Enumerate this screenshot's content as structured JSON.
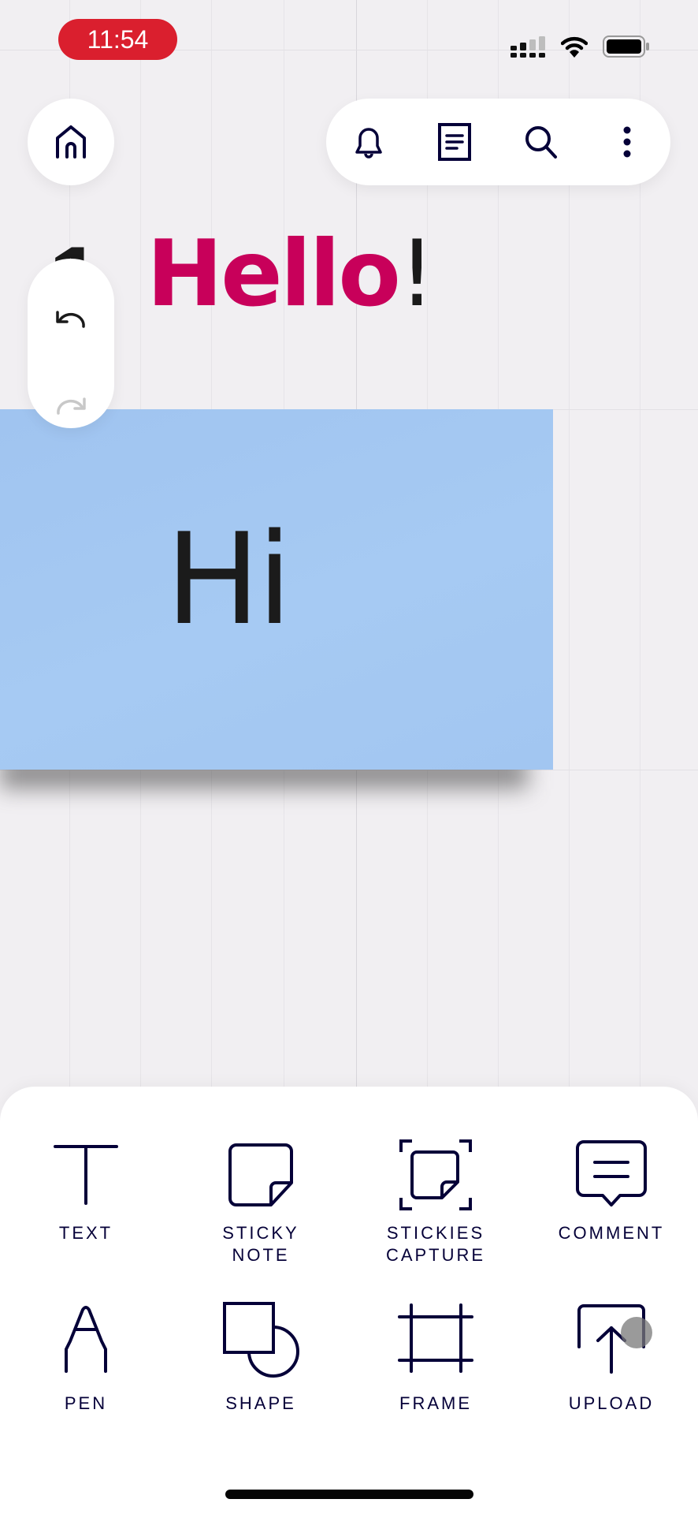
{
  "status_bar": {
    "time": "11:54",
    "time_pill_color": "#DA1F2E",
    "signal_strength_bars": 2,
    "signal_total_bars": 4,
    "wifi": "connected",
    "battery_level": 0.95
  },
  "top_bar": {
    "home_icon": "home-icon",
    "actions": [
      {
        "name": "notifications",
        "icon": "bell-icon"
      },
      {
        "name": "board-info",
        "icon": "document-icon"
      },
      {
        "name": "search",
        "icon": "search-icon"
      },
      {
        "name": "more",
        "icon": "more-vertical-icon"
      }
    ]
  },
  "history": {
    "undo_enabled": true,
    "redo_enabled": false
  },
  "canvas": {
    "partial_text": "1",
    "heading": {
      "word": "Hello",
      "punctuation": "!",
      "word_color": "#C8005A",
      "punctuation_color": "#1A1A1A"
    },
    "sticky_note": {
      "text": "Hi",
      "color": "#A3C6F2"
    }
  },
  "tool_panel": {
    "tools": [
      {
        "id": "text",
        "label": "TEXT",
        "icon": "text-t-icon"
      },
      {
        "id": "sticky-note",
        "label": "STICKY\nNOTE",
        "label_line1": "STICKY",
        "label_line2": "NOTE",
        "icon": "sticky-note-icon"
      },
      {
        "id": "stickies-capture",
        "label_line1": "STICKIES",
        "label_line2": "CAPTURE",
        "icon": "stickies-capture-icon"
      },
      {
        "id": "comment",
        "label": "COMMENT",
        "icon": "comment-icon"
      },
      {
        "id": "pen",
        "label": "PEN",
        "icon": "pen-icon"
      },
      {
        "id": "shape",
        "label": "SHAPE",
        "icon": "shape-icon"
      },
      {
        "id": "frame",
        "label": "FRAME",
        "icon": "frame-icon"
      },
      {
        "id": "upload",
        "label": "UPLOAD",
        "icon": "upload-icon"
      }
    ]
  },
  "colors": {
    "icon_ink": "#050038",
    "canvas_bg": "#F1EFF2",
    "panel_bg": "#FFFFFF"
  }
}
